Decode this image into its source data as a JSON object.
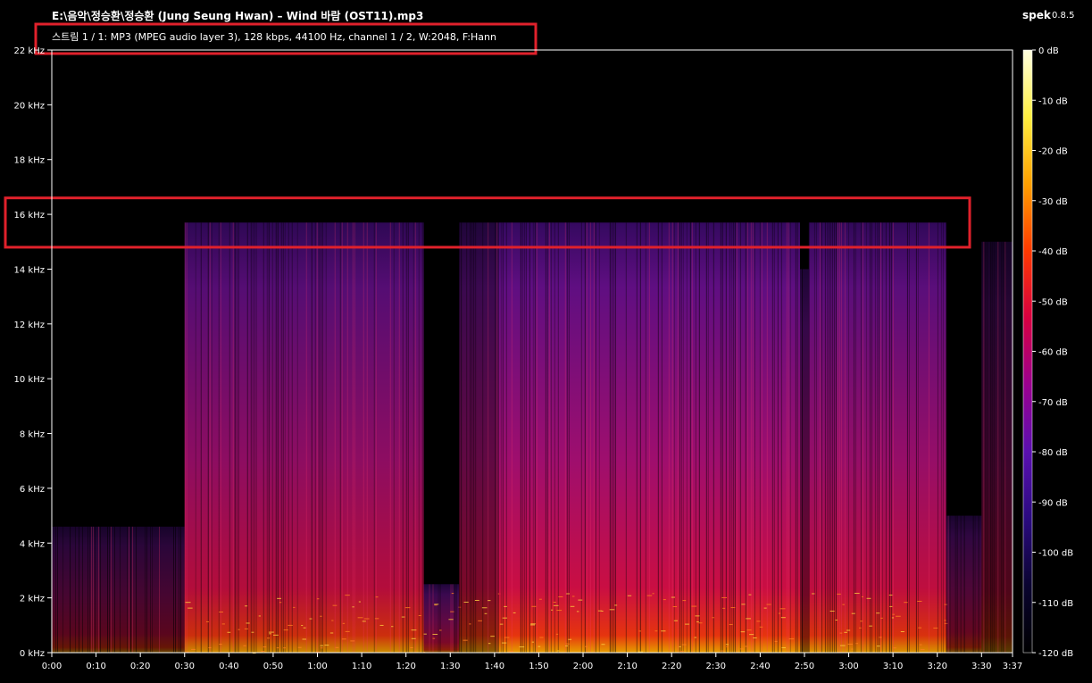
{
  "header": {
    "file_title": "E:\\음악\\정승환\\정승환 (Jung Seung Hwan) – Wind  바람 (OST11).mp3",
    "stream_info": "스트림 1 / 1: MP3 (MPEG audio layer 3), 128 kbps, 44100 Hz, channel 1 / 2, W:2048, F:Hann",
    "app_name": "spek",
    "app_version": "0.8.5"
  },
  "chart_data": {
    "type": "heatmap",
    "x_ticks": [
      "0:00",
      "0:10",
      "0:20",
      "0:30",
      "0:40",
      "0:50",
      "1:00",
      "1:10",
      "1:20",
      "1:30",
      "1:40",
      "1:50",
      "2:00",
      "2:10",
      "2:20",
      "2:30",
      "2:40",
      "2:50",
      "3:00",
      "3:10",
      "3:20",
      "3:30",
      "3:37"
    ],
    "x_tick_seconds": [
      0,
      10,
      20,
      30,
      40,
      50,
      60,
      70,
      80,
      90,
      100,
      110,
      120,
      130,
      140,
      150,
      160,
      170,
      180,
      190,
      200,
      210,
      217
    ],
    "xlim": [
      0,
      217
    ],
    "y_ticks": [
      "0 kHz",
      "2 kHz",
      "4 kHz",
      "6 kHz",
      "8 kHz",
      "10 kHz",
      "12 kHz",
      "14 kHz",
      "16 kHz",
      "18 kHz",
      "20 kHz",
      "22 kHz"
    ],
    "y_tick_khz": [
      0,
      2,
      4,
      6,
      8,
      10,
      12,
      14,
      16,
      18,
      20,
      22
    ],
    "ylim_khz": [
      0,
      22
    ],
    "colorbar_ticks": [
      "0 dB",
      "-10 dB",
      "-20 dB",
      "-30 dB",
      "-40 dB",
      "-50 dB",
      "-60 dB",
      "-70 dB",
      "-80 dB",
      "-90 dB",
      "-100 dB",
      "-110 dB",
      "-120 dB"
    ],
    "colorbar_db": [
      0,
      -10,
      -20,
      -30,
      -40,
      -50,
      -60,
      -70,
      -80,
      -90,
      -100,
      -110,
      -120
    ],
    "colorbar_colors": [
      "#ffffe0",
      "#ffee40",
      "#ffa000",
      "#ff3a00",
      "#d80040",
      "#9a0090",
      "#5a10b0",
      "#2a0a80",
      "#0a0430",
      "#000000"
    ],
    "cutoff_khz": 15.7,
    "segments": [
      {
        "start_s": 0,
        "end_s": 30,
        "top_khz": 4.6,
        "intensity": 0.4
      },
      {
        "start_s": 30,
        "end_s": 84,
        "top_khz": 15.7,
        "intensity": 0.8
      },
      {
        "start_s": 84,
        "end_s": 92,
        "top_khz": 2.5,
        "intensity": 0.55
      },
      {
        "start_s": 92,
        "end_s": 101,
        "top_khz": 15.7,
        "intensity": 0.55
      },
      {
        "start_s": 101,
        "end_s": 169,
        "top_khz": 15.7,
        "intensity": 0.9
      },
      {
        "start_s": 169,
        "end_s": 171,
        "top_khz": 14,
        "intensity": 0.5
      },
      {
        "start_s": 171,
        "end_s": 202,
        "top_khz": 15.7,
        "intensity": 0.85
      },
      {
        "start_s": 202,
        "end_s": 210,
        "top_khz": 5,
        "intensity": 0.45
      },
      {
        "start_s": 210,
        "end_s": 217,
        "top_khz": 15,
        "intensity": 0.35
      }
    ],
    "highlight_color": "#e0212b",
    "highlights": [
      {
        "target": "stream-info"
      },
      {
        "target": "cutoff-band",
        "low_khz": 14.8,
        "high_khz": 16.6
      }
    ]
  }
}
